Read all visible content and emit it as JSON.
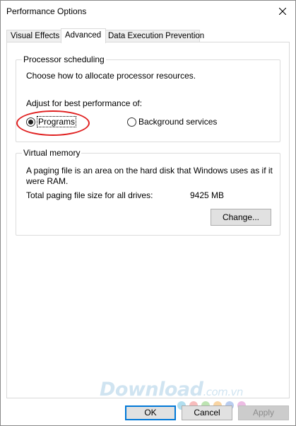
{
  "window": {
    "title": "Performance Options",
    "close_icon": "close-icon"
  },
  "tabs": [
    {
      "label": "Visual Effects",
      "active": false
    },
    {
      "label": "Advanced",
      "active": true
    },
    {
      "label": "Data Execution Prevention",
      "active": false
    }
  ],
  "processor_scheduling": {
    "title": "Processor scheduling",
    "description": "Choose how to allocate processor resources.",
    "adjust_label": "Adjust for best performance of:",
    "options": [
      {
        "label": "Programs",
        "selected": true
      },
      {
        "label": "Background services",
        "selected": false
      }
    ],
    "highlight_color": "#e02020"
  },
  "virtual_memory": {
    "title": "Virtual memory",
    "description_line1": "A paging file is an area on the hard disk that Windows uses as if it",
    "description_line2": "were RAM.",
    "total_label": "Total paging file size for all drives:",
    "total_value": "9425 MB",
    "change_button": "Change..."
  },
  "buttons": {
    "ok": "OK",
    "cancel": "Cancel",
    "apply": "Apply"
  },
  "watermark": {
    "main": "Download",
    "suffix": ".com.vn"
  }
}
